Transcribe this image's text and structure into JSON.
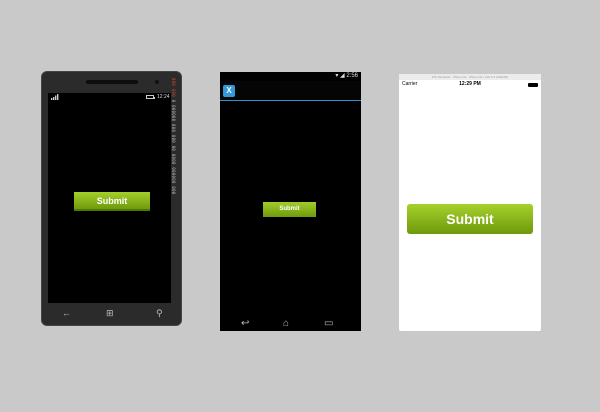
{
  "windows_phone": {
    "status_time": "12:24",
    "debug_counters": [
      {
        "text": "000",
        "hot": true
      },
      {
        "text": "000",
        "hot": true
      },
      {
        "text": "0 000000 000 000 00 0000",
        "hot": false
      },
      {
        "text": "000000 000",
        "hot": false
      }
    ],
    "submit_label": "Submit",
    "nav": {
      "back": "←",
      "start": "⊞",
      "search": "⚲"
    }
  },
  "android": {
    "status_time": "2:56",
    "app_logo": "X",
    "submit_label": "Submit",
    "nav": {
      "back": "↩",
      "home": "⌂",
      "recents": "▭"
    }
  },
  "ios": {
    "simulator_title": "iOS Simulator - iPhone 6s - iPhone 6s / iOS 9.3 (13E230)",
    "carrier": "Carrier",
    "status_time": "12:29 PM",
    "submit_label": "Submit"
  },
  "colors": {
    "button_top": "#a4d02a",
    "button_bottom": "#6f9a0c",
    "android_accent": "#2e8fd3"
  }
}
